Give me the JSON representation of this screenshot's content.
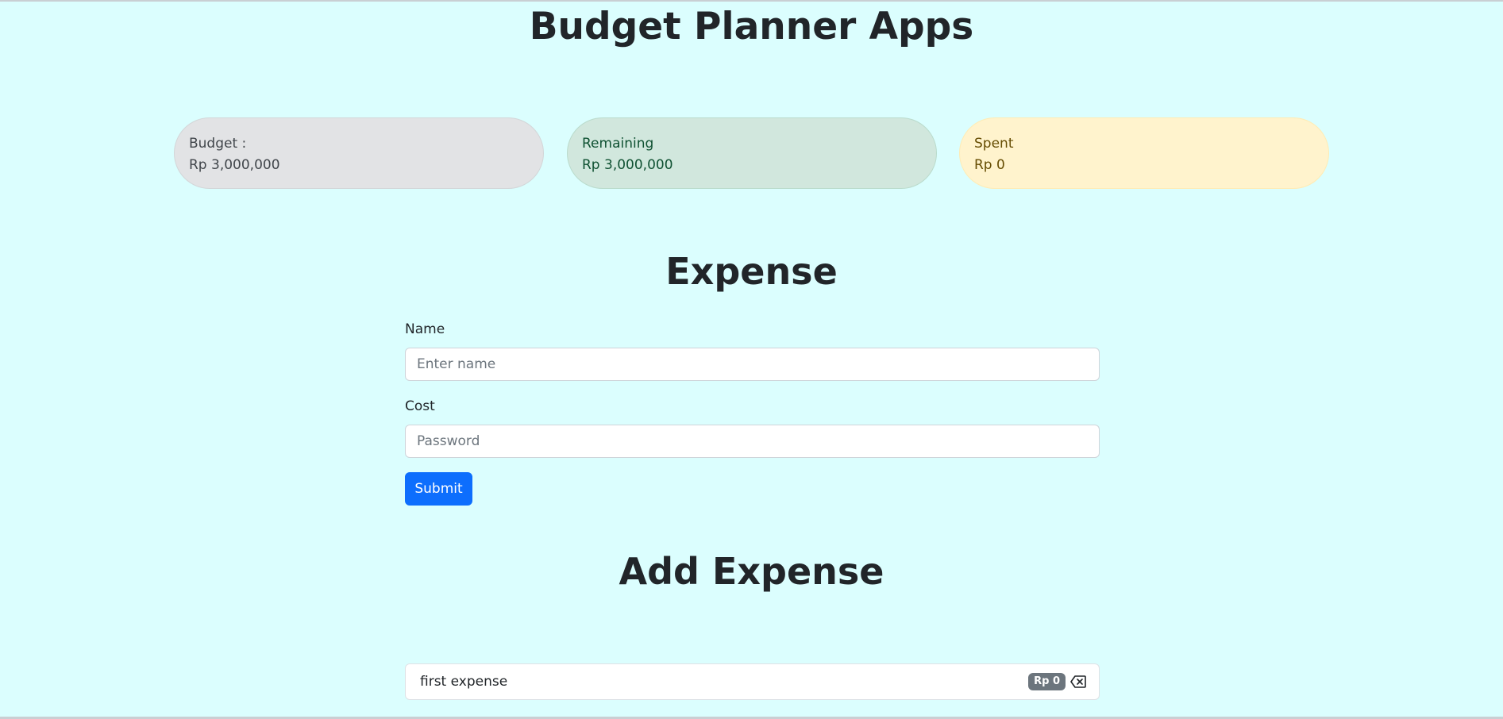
{
  "app": {
    "title": "Budget Planner Apps"
  },
  "stats": {
    "budget": {
      "label": "Budget :",
      "value": "Rp 3,000,000"
    },
    "remaining": {
      "label": "Remaining",
      "value": "Rp 3,000,000"
    },
    "spent": {
      "label": "Spent",
      "value": "Rp 0"
    }
  },
  "expense_form": {
    "title": "Expense",
    "name_label": "Name",
    "name_placeholder": "Enter name",
    "name_value": "",
    "cost_label": "Cost",
    "cost_placeholder": "Password",
    "cost_value": "",
    "submit_label": "Submit"
  },
  "expense_list": {
    "title": "Add Expense",
    "items": [
      {
        "name": "first expense",
        "cost": "Rp 0",
        "delete_icon": "backspace-icon"
      }
    ]
  },
  "colors": {
    "page_background": "#dbfefe",
    "primary": "#0d6efd",
    "budget_bg": "#e2e3e5",
    "remaining_bg": "#d1e7dd",
    "spent_bg": "#fff3cd",
    "badge_bg": "#6c757d"
  }
}
